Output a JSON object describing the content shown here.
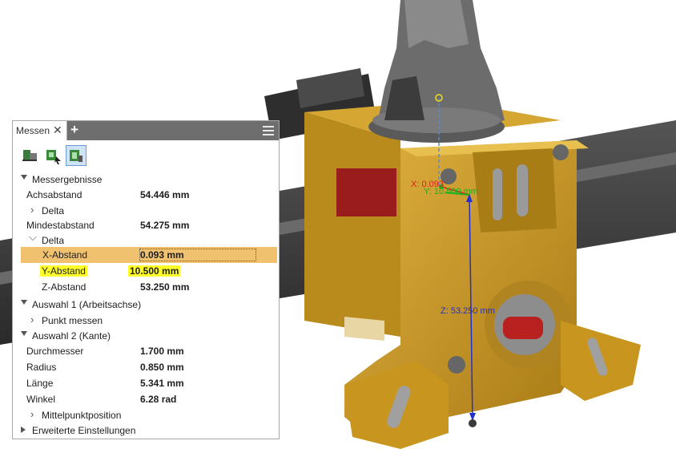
{
  "panel": {
    "tab_label": "Messen",
    "close_icon": "close-icon",
    "add_icon": "plus-icon",
    "menu_icon": "hamburger-menu-icon",
    "tools": [
      "measure-distance-icon",
      "measure-select-icon",
      "measure-advanced-icon"
    ],
    "section_results": "Messergebnisse",
    "achsabstand_label": "Achsabstand",
    "achsabstand_value": "54.446 mm",
    "delta1_label": "Delta",
    "mindestabstand_label": "Mindestabstand",
    "mindestabstand_value": "54.275 mm",
    "delta2_label": "Delta",
    "x_label": "X-Abstand",
    "x_value": "0.093 mm",
    "y_label": "Y-Abstand",
    "y_value": "10.500 mm",
    "z_label": "Z-Abstand",
    "z_value": "53.250 mm",
    "section_sel1": "Auswahl 1 (Arbeitsachse)",
    "punkt_label": "Punkt messen",
    "section_sel2": "Auswahl 2 (Kante)",
    "durchmesser_label": "Durchmesser",
    "durchmesser_value": "1.700 mm",
    "radius_label": "Radius",
    "radius_value": "0.850 mm",
    "laenge_label": "Länge",
    "laenge_value": "5.341 mm",
    "winkel_label": "Winkel",
    "winkel_value": "6.28 rad",
    "mittelpunkt_label": "Mittelpunktposition",
    "section_advanced": "Erweiterte Einstellungen"
  },
  "viewport": {
    "label_x": "X: 0.093",
    "label_y": "Y: 10.500 mm",
    "label_z": "Z: 53.250 mm",
    "colors": {
      "part_body": "#c8961e",
      "part_dark": "#7a5a10",
      "rail": "#3b3b3b",
      "x_axis": "#e02020",
      "y_axis": "#1fb01f",
      "z_axis": "#2030d0"
    }
  }
}
